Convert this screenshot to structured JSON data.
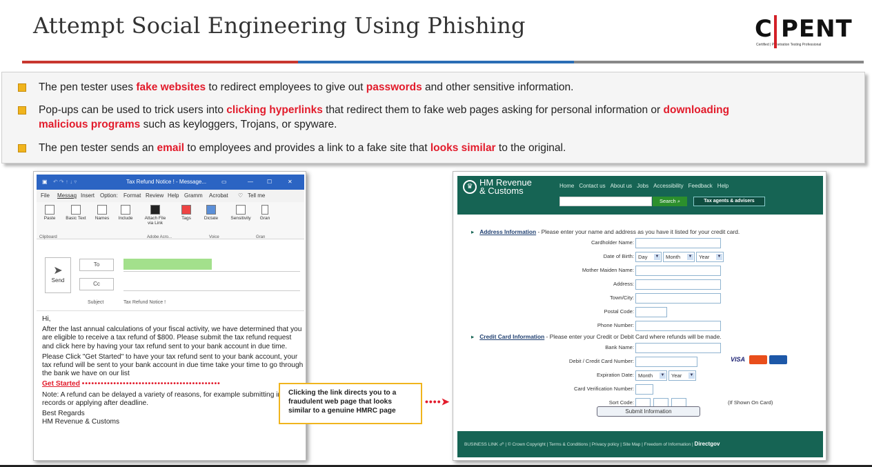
{
  "slide": {
    "title": "Attempt Social Engineering Using Phishing",
    "logo": {
      "text_left": "C",
      "text_right": "PENT",
      "tagline": "Certified  |  Penetration  Testing  Professional"
    }
  },
  "bullets": {
    "b1": {
      "pre": "The pen tester uses ",
      "h1": "fake websites",
      "mid": " to redirect employees to give out ",
      "h2": "passwords",
      "post": " and other sensitive information."
    },
    "b2": {
      "pre": "Pop-ups can be used to trick users into ",
      "h1": "clicking hyperlinks",
      "mid": " that redirect them to fake web pages asking for personal information or ",
      "h2": "downloading",
      "line2_h": "malicious programs",
      "line2_post": " such as keyloggers, Trojans, or spyware."
    },
    "b3": {
      "pre": "The pen tester sends an ",
      "h1": "email",
      "mid": " to employees and provides a link to a fake site that ",
      "h2": "looks similar",
      "post": " to the original."
    }
  },
  "outlook": {
    "window_title": "Tax Refund Notice ! - Message...",
    "tabs": [
      "File",
      "Messag",
      "Insert",
      "Option:",
      "Format",
      "Review",
      "Help",
      "Gramm",
      "Acrobat",
      "Tell me"
    ],
    "ribbon": {
      "paste": "Paste",
      "basic_text": "Basic Text",
      "names": "Names",
      "include": "Include",
      "attach": "Attach File via Link",
      "tags": "Tags",
      "dictate": "Dictate",
      "sensitivity": "Sensitivity",
      "grammarly": "Gran",
      "group_clipboard": "Clipboard",
      "group_adobe": "Adobe Acro...",
      "group_voice": "Voice",
      "group_gram": "Gran"
    },
    "send": "Send",
    "to": "To",
    "cc": "Cc",
    "subject_label": "Subject",
    "subject": "Tax Refund Notice !",
    "body": {
      "greeting": "Hi,",
      "p1": "After the last annual calculations of your fiscal activity, we have determined that you are eligible to receive a tax refund of $800. Please submit the tax refund request and click here by having your tax refund sent to your bank account in due time.",
      "p2": "Please Click \"Get Started\" to have your tax refund sent to your bank account, your tax refund will be sent to your bank account in due time take your time to go through the bank we have on our list",
      "link": "Get Started",
      "p3": "Note: A refund can be delayed a variety of reasons, for example submitting invalid records or applying after deadline.",
      "sign1": "Best Regards",
      "sign2": "HM Revenue & Customs"
    }
  },
  "callout": "Clicking the link directs you to a fraudulent web page that looks similar to a genuine HMRC page",
  "hmrc": {
    "brand": [
      "HM Revenue",
      "& Customs"
    ],
    "nav": [
      "Home",
      "Contact us",
      "About us",
      "Jobs",
      "Accessibility",
      "Feedback",
      "Help"
    ],
    "search_button": "Search",
    "agents_button": "Tax agents & advisers",
    "address_title": "Address Information",
    "address_desc": " - Please enter your name and address as you have it listed for your credit card.",
    "labels": {
      "cardholder": "Cardholder Name:",
      "dob": "Date of Birth:",
      "mother": "Mother Maiden Name:",
      "address": "Address:",
      "town": "Town/City:",
      "postal": "Postal Code:",
      "phone": "Phone Number:",
      "bank": "Bank Name:",
      "card": "Debit / Credit Card Number:",
      "exp": "Expiration Date:",
      "cvn": "Card Verification Number:",
      "sort": "Sort Code:"
    },
    "dob": {
      "day": "Day",
      "month": "Month",
      "year": "Year"
    },
    "exp": {
      "month": "Month",
      "year": "Year"
    },
    "card_title": "Credit Card Information",
    "card_desc": " - Please enter your Credit or Debit Card where refunds will be made.",
    "visa": "VISA",
    "sort_note": "(If Shown On Card)",
    "submit": "Submit Information",
    "footer": {
      "business": "BUSINESS LINK",
      "links": "|  © Crown Copyright  |  Terms & Conditions  |  Privacy policy  |  Site Map  |  Freedom of Information  |",
      "directgov": "Directgov"
    }
  },
  "colors": {
    "accent_red": "#e21b2b",
    "bullet_gold": "#f0b41d",
    "outlook_blue": "#2b64c3",
    "hmrc_green": "#166454"
  }
}
